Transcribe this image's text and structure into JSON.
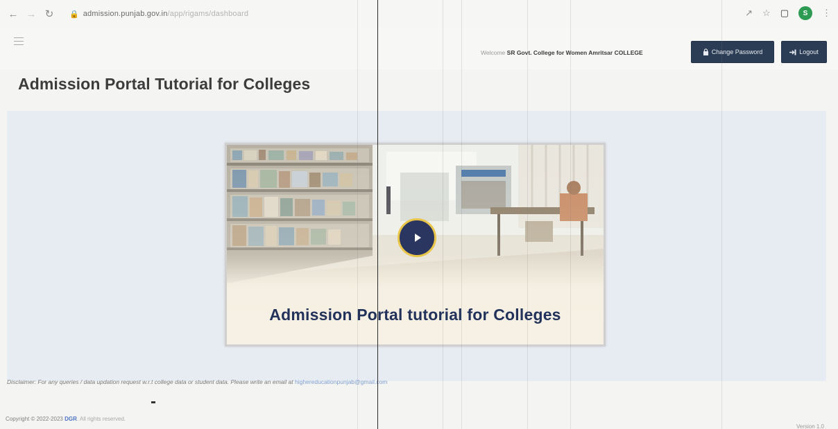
{
  "browser": {
    "url_domain": "admission.punjab.gov.in",
    "url_path": "/app/rigams/dashboard",
    "profile_initial": "S",
    "icons": [
      "back-icon",
      "forward-icon",
      "reload-icon",
      "lock-icon",
      "share-icon",
      "star-icon",
      "sidebar-icon",
      "menu-dots-icon"
    ]
  },
  "header": {
    "welcome_label": "Welcome",
    "college_name": "SR Govt. College for Women Amritsar COLLEGE",
    "change_password_label": "Change Password",
    "logout_label": "Logout"
  },
  "page": {
    "title": "Admission Portal Tutorial for Colleges"
  },
  "video": {
    "caption": "Admission Portal tutorial for Colleges"
  },
  "disclaimer": {
    "text": "Disclaimer: For any queries / data updation request w.r.t college data or student data. Please write an email at",
    "email": "highereducationpunjab@gmail.com"
  },
  "footer": {
    "copyright": "Copyright © 2022-2023",
    "org": "DGR",
    "rights": ". All rights reserved.",
    "version": "Version 1.0"
  },
  "colors": {
    "button_bg": "#2b3d55",
    "panel_bg": "#e7ecf2",
    "caption": "#22325a",
    "play_ring": "#e9c64a"
  }
}
